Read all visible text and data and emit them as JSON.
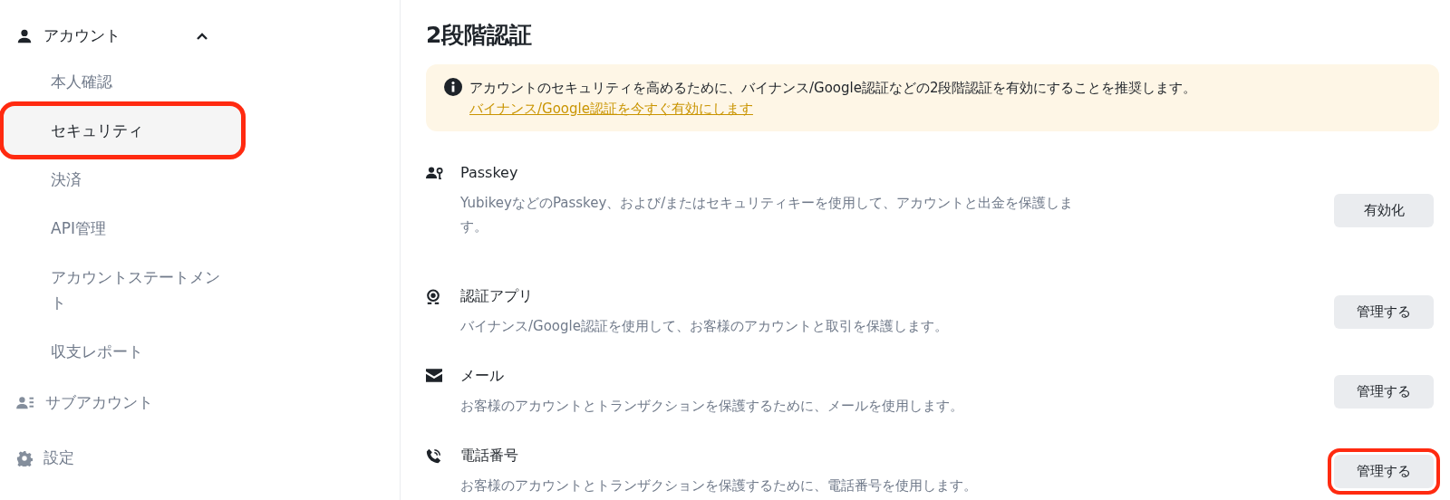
{
  "sidebar": {
    "items": [
      {
        "kind": "group",
        "label": "アカウント",
        "expanded": true,
        "children": [
          {
            "label": "本人確認",
            "selected": false,
            "highlighted": false
          },
          {
            "label": "セキュリティ",
            "selected": true,
            "highlighted": true
          },
          {
            "label": "決済",
            "selected": false,
            "highlighted": false
          },
          {
            "label": "API管理",
            "selected": false,
            "highlighted": false
          },
          {
            "label": "アカウントステートメント",
            "selected": false,
            "highlighted": false
          },
          {
            "label": "収支レポート",
            "selected": false,
            "highlighted": false
          }
        ]
      },
      {
        "kind": "link",
        "label": "サブアカウント"
      },
      {
        "kind": "link",
        "label": "設定"
      }
    ]
  },
  "main": {
    "title": "2段階認証",
    "notice": {
      "text": "アカウントのセキュリティを高めるために、バイナンス/Google認証などの2段階認証を有効にすることを推奨します。",
      "link": "バイナンス/Google認証を今すぐ有効にします"
    },
    "methods": [
      {
        "name": "Passkey",
        "description": "YubikeyなどのPasskey、および/またはセキュリティキーを使用して、アカウントと出金を保護します。",
        "button": "有効化",
        "highlighted": false
      },
      {
        "name": "認証アプリ",
        "description": "バイナンス/Google認証を使用して、お客様のアカウントと取引を保護します。",
        "button": "管理する",
        "highlighted": false
      },
      {
        "name": "メール",
        "description": "お客様のアカウントとトランザクションを保護するために、メールを使用します。",
        "button": "管理する",
        "highlighted": false
      },
      {
        "name": "電話番号",
        "description": "お客様のアカウントとトランザクションを保護するために、電話番号を使用します。",
        "button": "管理する",
        "highlighted": true
      }
    ]
  }
}
